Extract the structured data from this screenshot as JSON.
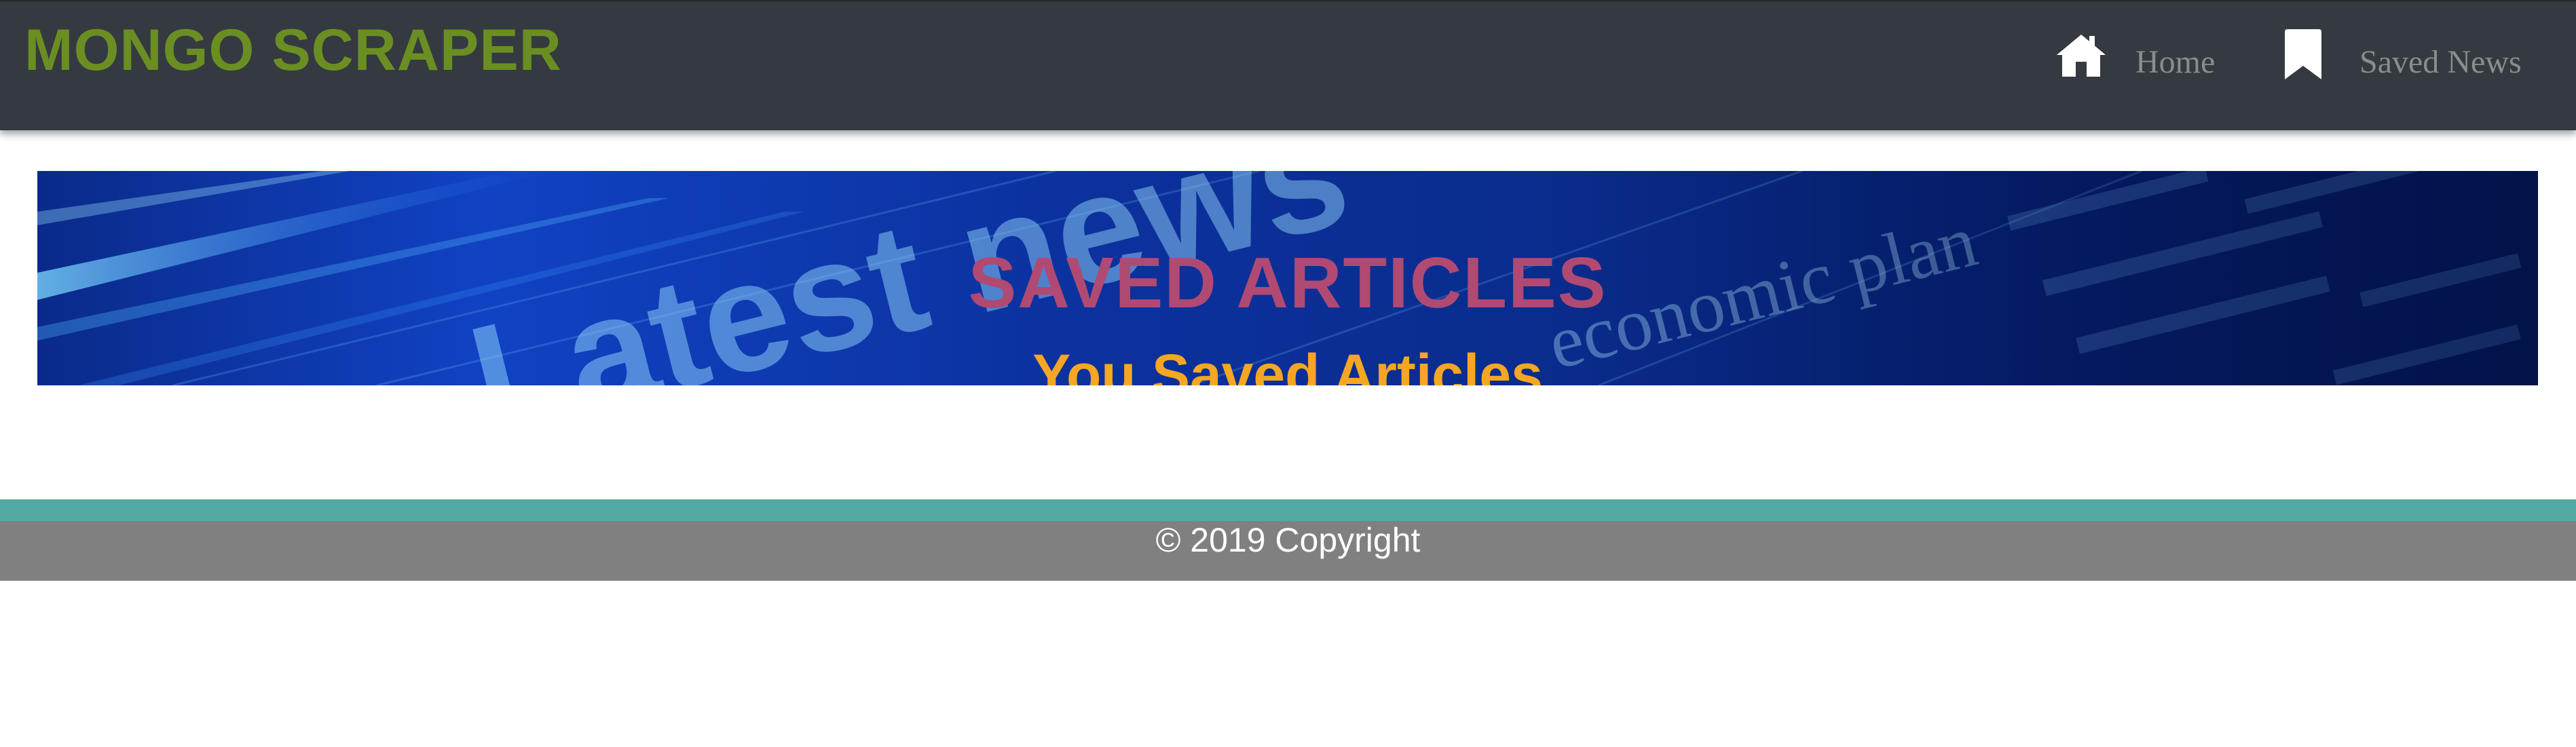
{
  "navbar": {
    "brand": "MONGO SCRAPER",
    "links": [
      {
        "label": "Home",
        "icon": "home-icon"
      },
      {
        "label": "Saved News",
        "icon": "bookmark-icon"
      }
    ]
  },
  "hero": {
    "title": "SAVED ARTICLES",
    "subtitle": "You Saved Articles",
    "background_image_text": [
      "Latest news",
      "economic plan"
    ]
  },
  "footer": {
    "copyright": "© 2019 Copyright"
  },
  "colors": {
    "navbar_bg": "#343a40",
    "brand": "#6b8e23",
    "nav_link": "#8c8c8c",
    "hero_title": "#b04a72",
    "hero_subtitle": "#f5a623",
    "footer_stripe": "#53a9a3",
    "footer_bg": "#808080"
  }
}
